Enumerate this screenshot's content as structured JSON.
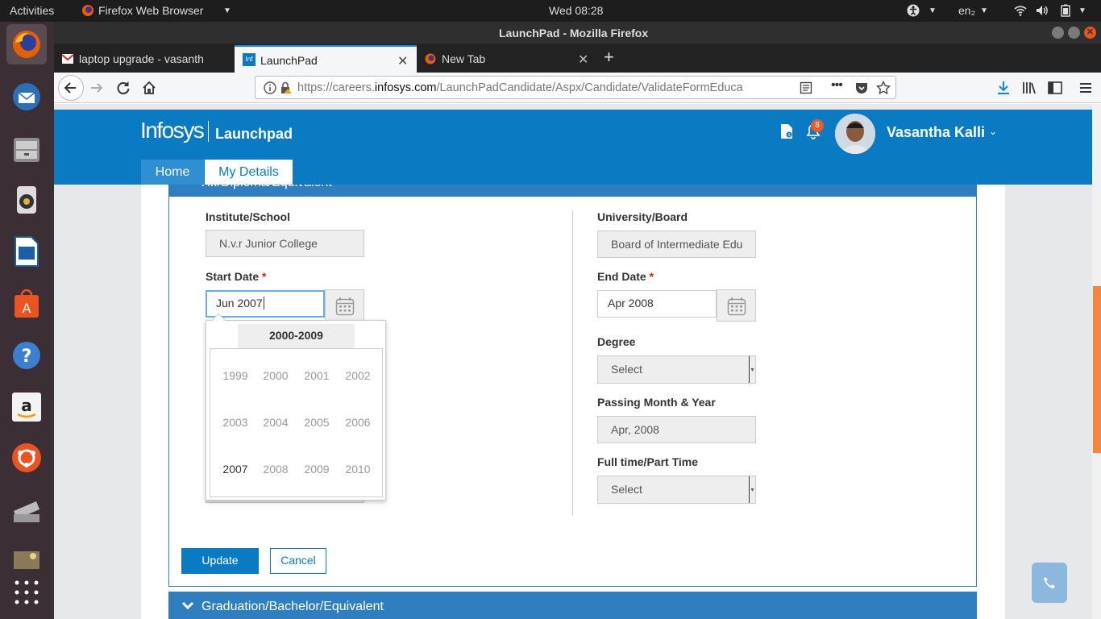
{
  "system": {
    "activities": "Activities",
    "app_menu": "Firefox Web Browser",
    "clock": "Wed 08:28",
    "keyboard": "en₂"
  },
  "window": {
    "title": "LaunchPad - Mozilla Firefox"
  },
  "tabs": [
    {
      "label": "laptop upgrade - vasanth"
    },
    {
      "label": "LaunchPad"
    },
    {
      "label": "New Tab"
    }
  ],
  "url": {
    "prefix": "https://careers.",
    "domain": "infosys.com",
    "path": "/LaunchPadCandidate/Aspx/Candidate/ValidateFormEduca"
  },
  "site": {
    "logo": "Infosys",
    "logo_sub": "Launchpad",
    "notif_count": "8",
    "user_name": "Vasantha Kalli",
    "nav": [
      "Home",
      "My Details"
    ],
    "section_top": "XII/Diploma/Equivalent"
  },
  "form": {
    "institute_label": "Institute/School",
    "institute_value": "N.v.r Junior College",
    "university_label": "University/Board",
    "university_value": "Board of Intermediate Edu",
    "start_label": "Start Date",
    "required_mark": "*",
    "start_value": "Jun 2007",
    "end_label": "End Date",
    "end_value": "Apr 2008",
    "degree_label": "Degree",
    "degree_value": "Select",
    "passing_label": "Passing Month & Year",
    "passing_value": "Apr, 2008",
    "fulltime_label": "Full time/Part Time",
    "fulltime_value": "Select",
    "update": "Update",
    "cancel": "Cancel"
  },
  "picker": {
    "header": "2000-2009",
    "years": [
      "1999",
      "2000",
      "2001",
      "2002",
      "2003",
      "2004",
      "2005",
      "2006",
      "2007",
      "2008",
      "2009",
      "2010"
    ],
    "selected": "2007"
  },
  "next_section": "Graduation/Bachelor/Equivalent",
  "colors": {
    "brand": "#0a7bc3",
    "section": "#2f7fc0",
    "required": "#d9221c"
  }
}
